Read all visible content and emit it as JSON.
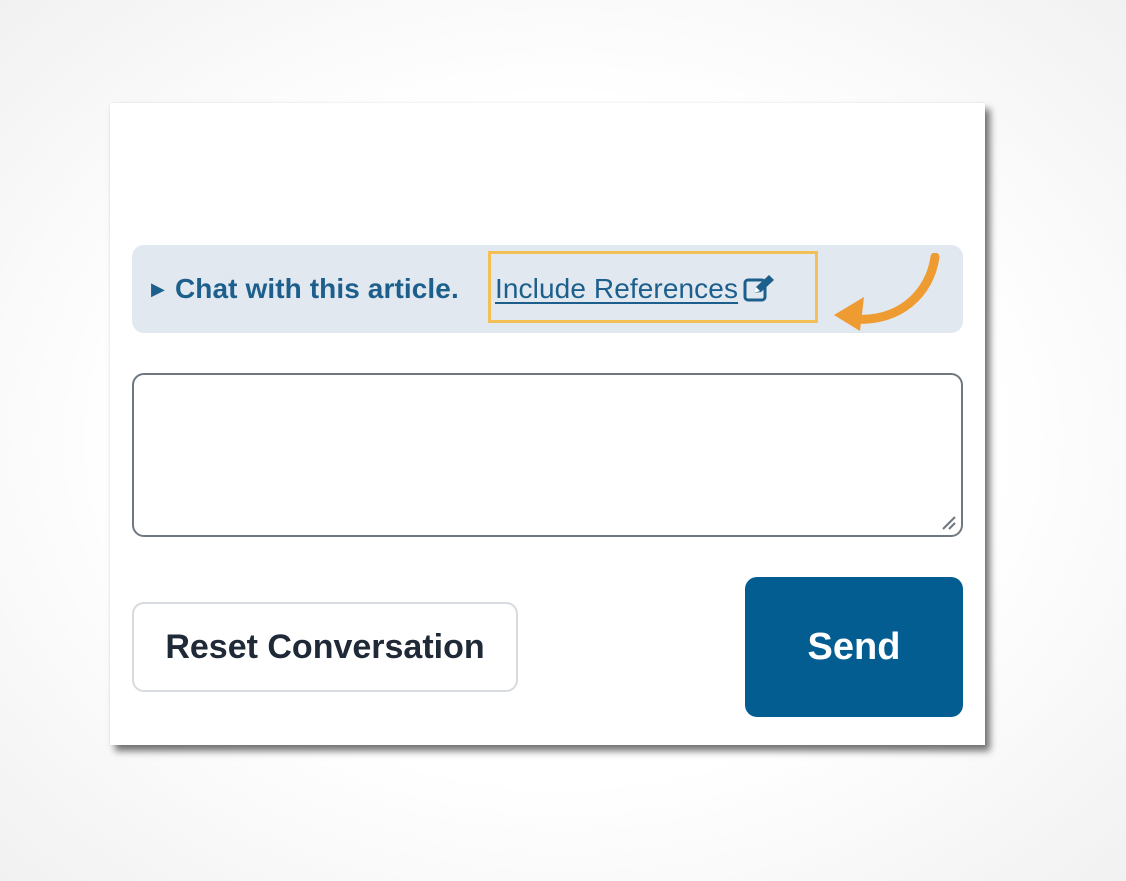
{
  "chat_panel": {
    "summary_prefix": "Chat with this article.",
    "include_references_label": "Include References",
    "edit_icon": "edit-icon",
    "expand_icon": "triangle-right-icon"
  },
  "input": {
    "value": "",
    "placeholder": ""
  },
  "buttons": {
    "reset_label": "Reset Conversation",
    "send_label": "Send"
  },
  "colors": {
    "accent": "#045d91",
    "link": "#1d5f8c",
    "summary_bg": "#e1e8f0",
    "highlight": "#f2c057",
    "arrow": "#ee9b32"
  }
}
